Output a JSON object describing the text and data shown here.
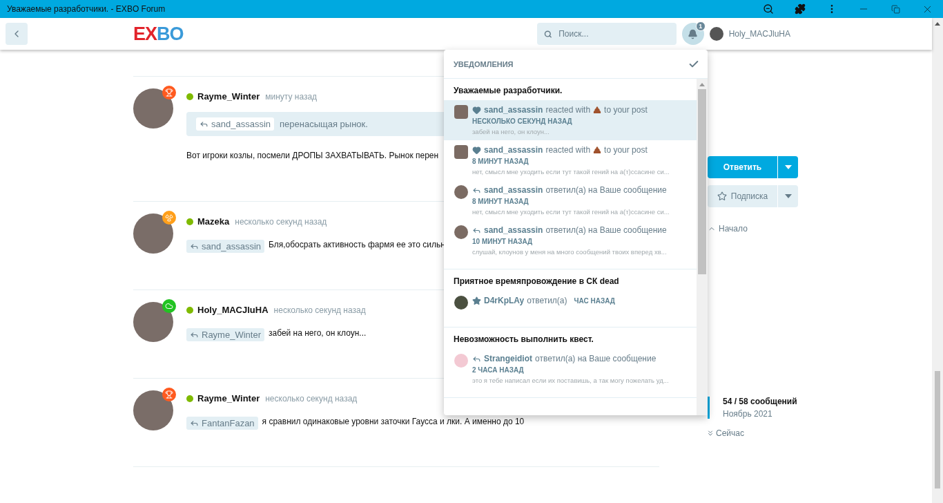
{
  "window": {
    "title": "Уважаемые разработчики. - EXBO Forum"
  },
  "header": {
    "logo": {
      "left": "EX",
      "right": "BO"
    },
    "search": {
      "placeholder": "Поиск..."
    },
    "notification_count": "1",
    "user": "Holy_MACJluHA"
  },
  "posts": [
    {
      "user": "Rayme_Winter",
      "time": "минуту назад",
      "online": true,
      "badge": {
        "kind": "trophy",
        "color": "#ff5a1f"
      },
      "kind": "quote",
      "reply_to": "sand_assassin",
      "quote": "перенасыщая рынок.",
      "text": "Вот игроки козлы, посмели ДРОПЫ ЗАХВАТЫВАТЬ. Рынок перен"
    },
    {
      "user": "Mazeka",
      "time": "несколько секунд назад",
      "online": true,
      "badge": {
        "kind": "radiation",
        "color": "#ff9f1a"
      },
      "kind": "reply",
      "reply_to": "sand_assassin",
      "text": "Бля,обосрать активность фармя ее это сильн"
    },
    {
      "user": "Holy_MACJluHA",
      "time": "несколько секунд назад",
      "online": true,
      "badge": {
        "kind": "cloud",
        "color": "#22c322"
      },
      "kind": "reply",
      "reply_to": "Rayme_Winter",
      "text": "забей на него, он клоун..."
    },
    {
      "user": "Rayme_Winter",
      "time": "несколько секунд назад",
      "online": true,
      "badge": {
        "kind": "trophy",
        "color": "#ff5a1f"
      },
      "kind": "reply",
      "reply_to": "FantanFazan",
      "text": "я сравнил одинаковые уровни заточки Гаусса и лки. А именно до 10"
    }
  ],
  "sidebar": {
    "reply_button": "Ответить",
    "follow_button": "Подписка",
    "start_link": "Начало",
    "scrubber": {
      "count": "54 / 58 сообщений",
      "date": "Ноябрь 2021",
      "now": "Сейчас"
    }
  },
  "notifications": {
    "title": "УВЕДОМЛЕНИЯ",
    "groups": [
      {
        "title": "Уважаемые разработчики.",
        "items": [
          {
            "kind": "reaction",
            "user": "sand_assassin",
            "action": "reacted with",
            "action_end": "to your post",
            "time": "НЕСКОЛЬКО СЕКУНД НАЗАД",
            "excerpt": "забей на него, он клоун...",
            "unread": true
          },
          {
            "kind": "reaction",
            "user": "sand_assassin",
            "action": "reacted with",
            "action_end": "to your post",
            "time": "8 МИНУТ НАЗАД",
            "excerpt": "нет, смысл мне уходить если тут такой гений на а(т)ссасине си...",
            "unread": false
          },
          {
            "kind": "reply",
            "user": "sand_assassin",
            "action": "ответил(а) на Ваше сообщение",
            "time": "8 МИНУТ НАЗАД",
            "excerpt": "нет, смысл мне уходить если тут такой гений на а(т)ссасине си...",
            "unread": false
          },
          {
            "kind": "reply",
            "user": "sand_assassin",
            "action": "ответил(а) на Ваше сообщение",
            "time": "10 МИНУТ НАЗАД",
            "excerpt": "слушай, клоунов у меня на много сообщений твоих вперед хв...",
            "unread": false
          }
        ]
      },
      {
        "title": "Приятное времяпровождение в СК dead",
        "items": [
          {
            "kind": "star",
            "user": "D4rKpLAy",
            "action": "ответил(а)",
            "time": "ЧАС НАЗАД",
            "unread": false
          }
        ]
      },
      {
        "title": "Невозможность выполнить квест.",
        "items": [
          {
            "kind": "reply",
            "user": "Strangeidiot",
            "action": "ответил(а) на Ваше сообщение",
            "time": "2 ЧАСА НАЗАД",
            "excerpt": "это я тебе написал если их поставишь, а так могу пожелать уд...",
            "unread": false
          }
        ]
      }
    ]
  }
}
